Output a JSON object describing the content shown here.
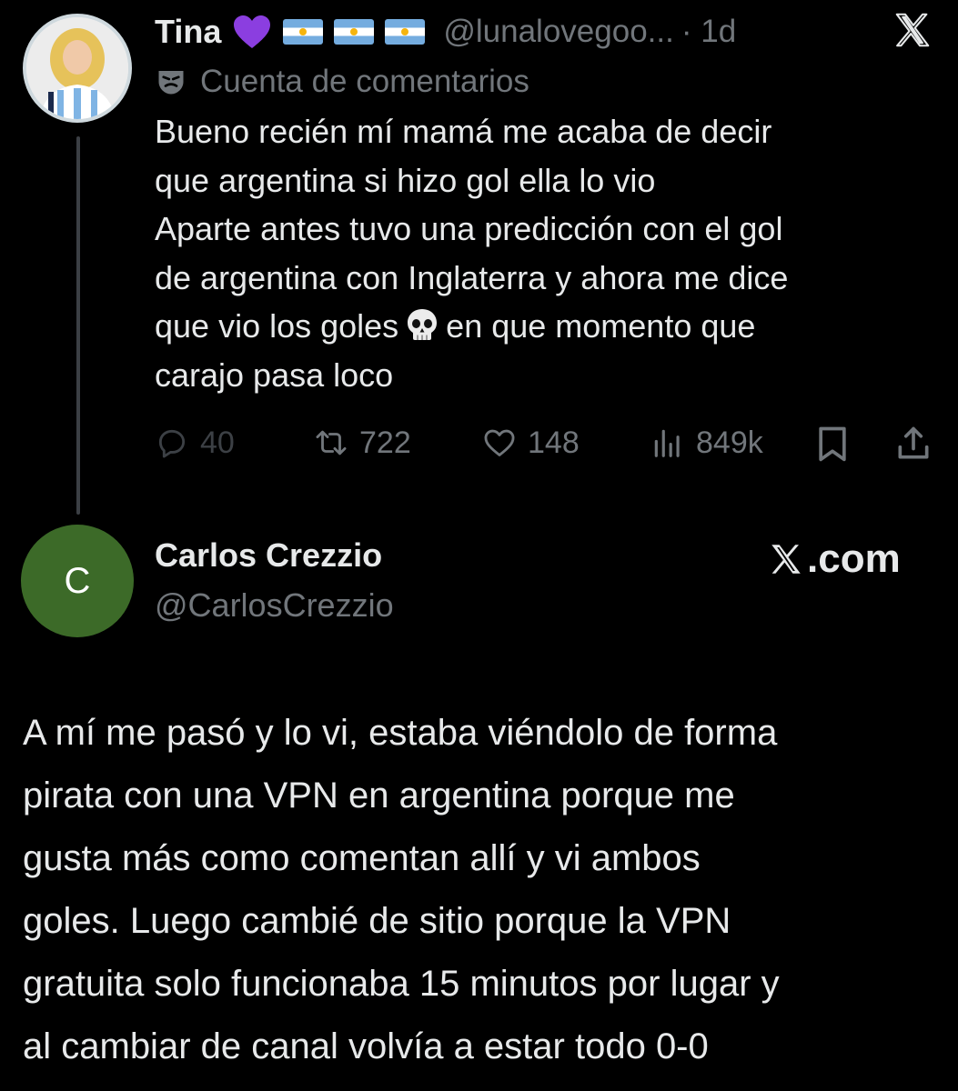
{
  "tweet1": {
    "author_name": "Tina",
    "handle": "@lunalovegoo...",
    "time": "· 1d",
    "label": "Cuenta de comentarios",
    "text_lines": [
      "Bueno recién mí mamá me acaba de decir",
      "que argentina si hizo gol ella lo vio",
      "Aparte antes tuvo una predicción con el gol",
      "de argentina con Inglaterra y ahora me dice",
      "que vio los goles",
      "en que momento que",
      "carajo pasa loco"
    ],
    "actions": {
      "replies": "40",
      "reposts": "722",
      "likes": "148",
      "views": "849k"
    },
    "icons": [
      "purple-heart-icon",
      "argentina-flag-icon",
      "x-logo-icon",
      "mask-icon",
      "skull-icon",
      "reply-icon",
      "repost-icon",
      "like-icon",
      "views-icon",
      "bookmark-icon",
      "share-icon"
    ]
  },
  "tweet2": {
    "author_name": "Carlos Crezzio",
    "handle": "@CarlosCrezzio",
    "avatar_initial": "C",
    "source": ".com",
    "text_lines": [
      "A mí me pasó y lo vi, estaba viéndolo de forma",
      "pirata con una VPN en argentina porque me",
      "gusta más como comentan allí y vi ambos",
      "goles. Luego cambié de sitio porque la VPN",
      "gratuita solo funcionaba 15 minutos por lugar y",
      "al cambiar de canal volvía a estar todo 0-0"
    ]
  },
  "colors": {
    "background": "#000000",
    "text": "#e7e9ea",
    "muted": "#71767b",
    "avatar2": "#3c6a28",
    "heart": "#8b3ee0"
  }
}
